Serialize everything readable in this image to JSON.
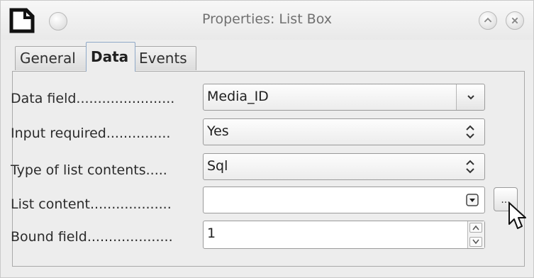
{
  "window": {
    "title": "Properties: List Box"
  },
  "tabs": [
    {
      "label": "General"
    },
    {
      "label": "Data"
    },
    {
      "label": "Events"
    }
  ],
  "fields": {
    "data_field": {
      "label": "Data field.......................",
      "value": "Media_ID"
    },
    "input_required": {
      "label": "Input required...............",
      "value": "Yes"
    },
    "type_list_contents": {
      "label": "Type of list contents.....",
      "value": "Sql"
    },
    "list_content": {
      "label": "List content...................",
      "value": ""
    },
    "bound_field": {
      "label": "Bound field....................",
      "value": "1"
    }
  },
  "ellipsis_button": {
    "label": "..."
  }
}
